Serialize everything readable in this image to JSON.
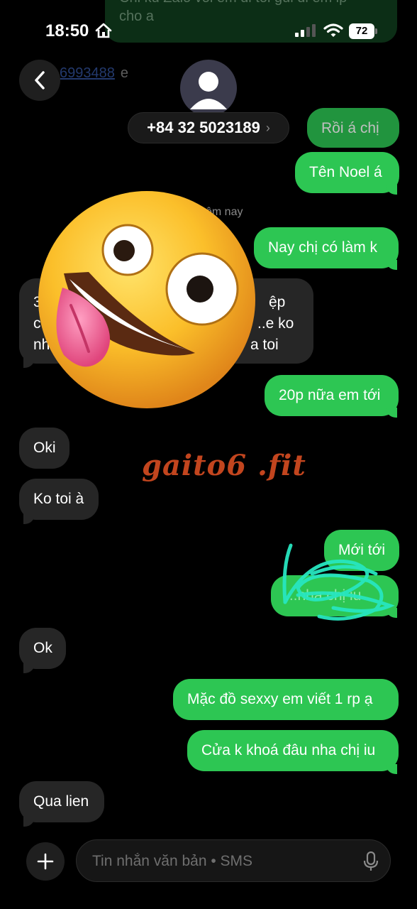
{
  "status_bar": {
    "time": "18:50",
    "battery": "72"
  },
  "header": {
    "contact_number": "+84 32 5023189",
    "faded_link_text": "6993488",
    "faded_link_suffix": "e",
    "top_faded_text_1": "Chi ku Zalo voi em di toi gui di em ip",
    "top_faded_text_2": "cho a"
  },
  "date_label": "ôm nay",
  "messages": [
    {
      "dir": "out",
      "text": "Rồi á chị"
    },
    {
      "dir": "out",
      "text": "Tên Noel á"
    },
    {
      "dir": "out",
      "text": "Nay chị có làm k"
    },
    {
      "dir": "in",
      "text_1": "3",
      "text_2": "ệp",
      "text_3": "c",
      "text_4": "..e ko",
      "text_5": "nh",
      "text_6": "a toi"
    },
    {
      "dir": "out",
      "text": "20p nữa em tới"
    },
    {
      "dir": "in",
      "text": "Oki"
    },
    {
      "dir": "in",
      "text": "Ko toi à"
    },
    {
      "dir": "out",
      "text": "Mới tới"
    },
    {
      "dir": "out",
      "text": "...nha chị iu"
    },
    {
      "dir": "in",
      "text": "Ok"
    },
    {
      "dir": "out",
      "text": "Mặc đồ sexxy em viết 1 rp ạ"
    },
    {
      "dir": "out",
      "text": "Cửa k khoá đâu nha chị iu"
    },
    {
      "dir": "in",
      "text": "Qua lien"
    }
  ],
  "watermark": "gaito6 .fit",
  "compose": {
    "placeholder": "Tin nhắn văn bản • SMS"
  },
  "icons": [
    "home-icon",
    "signal-icon",
    "wifi-icon",
    "battery-icon",
    "back-arrow-icon",
    "avatar-icon",
    "chevron-right-icon",
    "plus-icon",
    "mic-icon",
    "zany-face-emoji"
  ],
  "colors": {
    "outgoing": "#2dc653",
    "incoming": "#262626",
    "background": "#000000",
    "watermark": "#c2451e",
    "scribble": "#27e6c0"
  }
}
